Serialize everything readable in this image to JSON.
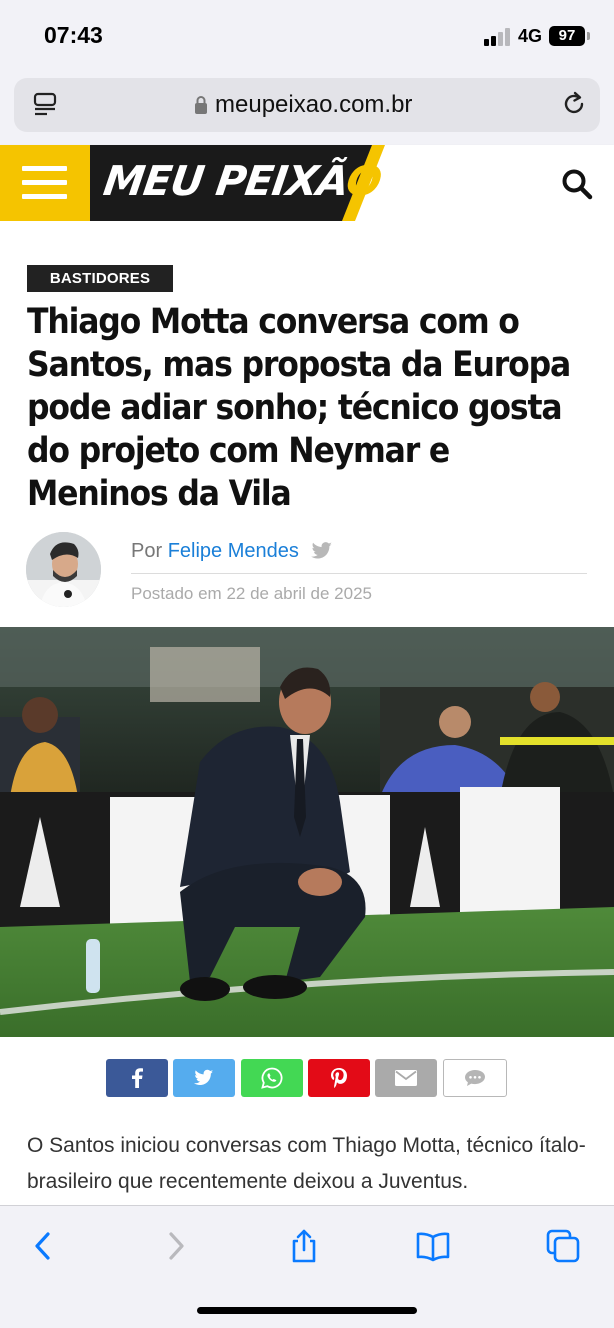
{
  "status_bar": {
    "time": "07:43",
    "network": "4G",
    "battery": "97"
  },
  "browser": {
    "url": "meupeixao.com.br"
  },
  "site": {
    "logo_main": "MEU PEIXÃ",
    "logo_accent": "O",
    "accent_color": "#f5c400"
  },
  "article": {
    "category": "BASTIDORES",
    "headline": "Thiago Motta conversa com o Santos, mas proposta da Europa pode adiar sonho; técnico gosta do projeto com Neymar e Meninos da Vila",
    "byline_prefix": "Por",
    "author": "Felipe Mendes",
    "posted": "Postado em 22 de abril de 2025",
    "paragraph": "O Santos iniciou conversas com Thiago Motta, técnico ítalo-brasileiro que recentemente deixou a Juventus."
  },
  "share_buttons": [
    {
      "name": "facebook",
      "icon": "facebook-icon",
      "color": "#3b5998"
    },
    {
      "name": "twitter",
      "icon": "twitter-icon",
      "color": "#55acee"
    },
    {
      "name": "whatsapp",
      "icon": "whatsapp-icon",
      "color": "#43d854"
    },
    {
      "name": "pinterest",
      "icon": "pinterest-icon",
      "color": "#e30b17"
    },
    {
      "name": "email",
      "icon": "mail-icon",
      "color": "#aaaaaa"
    },
    {
      "name": "comments",
      "icon": "comment-icon",
      "color": "#ffffff"
    }
  ]
}
